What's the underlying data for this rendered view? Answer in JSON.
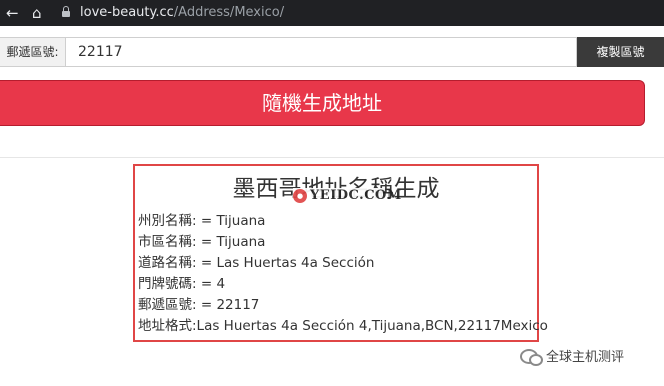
{
  "browser": {
    "back_icon": "back-arrow-icon",
    "home_icon": "home-icon",
    "url_host": "love-beauty.cc",
    "url_path": "/Address/Mexico/"
  },
  "postal": {
    "label": "郵遞區號:",
    "value": "22117",
    "copy_label": "複製區號"
  },
  "generate": {
    "label": "隨機生成地址"
  },
  "result": {
    "title": "墨西哥地址名稱生成",
    "watermark_logo": "YEIDC.COM",
    "rows": [
      "州別名稱: = Tijuana",
      "市區名稱: = Tijuana",
      "道路名稱: = Las Huertas 4a Sección",
      "門牌號碼: = 4",
      "郵遞區號: = 22117",
      "地址格式:Las Huertas 4a Sección 4,Tijuana,BCN,22117Mexico"
    ]
  },
  "watermark": {
    "text": "全球主机测评"
  },
  "colors": {
    "accent_red": "#e8374a",
    "panel_border": "#e04646",
    "chrome_bg": "#202124",
    "copy_button_bg": "#3a3a3a"
  }
}
